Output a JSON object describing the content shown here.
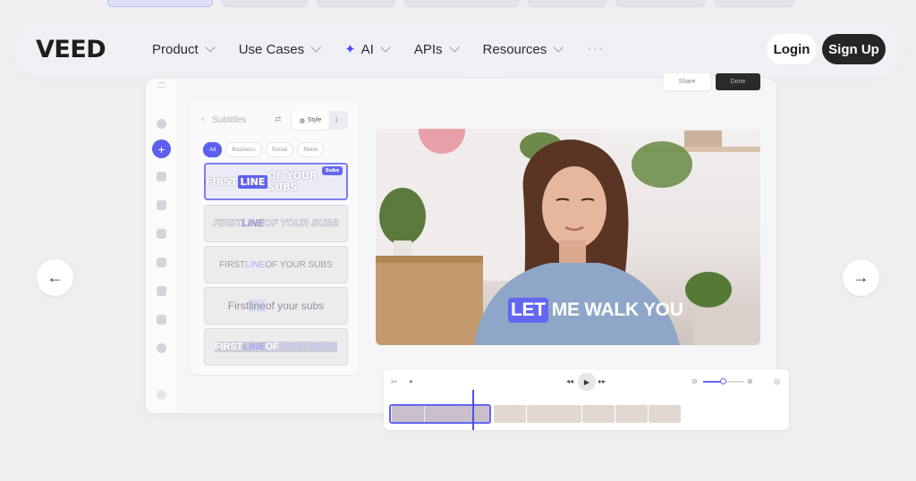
{
  "navbar": {
    "logo": "VEED",
    "items": [
      {
        "label": "Product"
      },
      {
        "label": "Use Cases"
      },
      {
        "label": "AI"
      },
      {
        "label": "APIs"
      },
      {
        "label": "Resources"
      }
    ],
    "more": "···",
    "login_label": "Login",
    "signup_label": "Sign Up"
  },
  "editor": {
    "share_label": "Share",
    "done_label": "Done",
    "subtitles_panel": {
      "title": "Subtitles",
      "style_label": "Style",
      "filters": [
        "All",
        "Business",
        "Social",
        "Retro"
      ],
      "active_filter": "All",
      "styles": [
        {
          "parts": [
            "FIRST ",
            "LINE",
            " OF YOUR SUBS"
          ],
          "badge": "Subs"
        },
        {
          "parts": [
            "FIRST ",
            "LINE",
            " OF YOUR SUBS"
          ]
        },
        {
          "parts": [
            "FIRST ",
            "LINE",
            " OF YOUR SUBS"
          ]
        },
        {
          "parts": [
            "First ",
            "line",
            " of your subs"
          ]
        },
        {
          "parts": [
            "FIRST ",
            "LINE",
            " OF ",
            "YOUR SUBS"
          ]
        }
      ]
    },
    "video": {
      "caption_highlight": "LET",
      "caption_rest": "ME WALK YOU"
    }
  },
  "colors": {
    "accent": "#6366f1",
    "dark": "#262628"
  }
}
